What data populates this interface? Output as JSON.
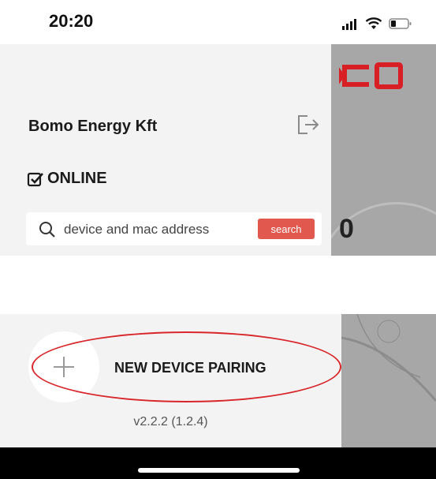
{
  "status_bar": {
    "time": "20:20",
    "icons": [
      "cellular-signal-icon",
      "wifi-icon",
      "battery-icon"
    ]
  },
  "drawer": {
    "company_name": "Bomo Energy Kft",
    "logout_icon": "logout-icon",
    "online_status": {
      "icon": "checkbox-checked-icon",
      "label": "ONLINE"
    },
    "search": {
      "icon": "search-icon",
      "placeholder": "device and mac address",
      "button_label": "search"
    },
    "pairing": {
      "icon": "plus-icon",
      "label": "NEW DEVICE PAIRING"
    },
    "version": "v2.2.2 (1.2.4)"
  },
  "background_app": {
    "gauge_value": "0"
  },
  "colors": {
    "accent": "#e0584e",
    "highlight": "#d8262b",
    "brand_red": "#d81f26",
    "drawer_bg": "#f3f3f3",
    "overlay_bg": "#a7a7a7"
  }
}
